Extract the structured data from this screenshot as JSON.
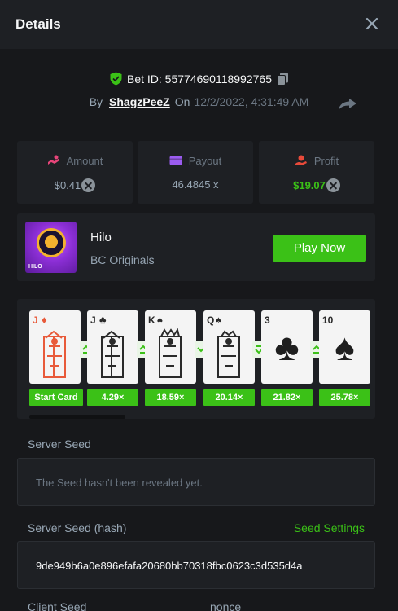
{
  "header": {
    "title": "Details"
  },
  "bet": {
    "id_label": "Bet ID: 55774690118992765",
    "by_label": "By",
    "username": "ShagzPeeZ",
    "on_label": "On",
    "date": "12/2/2022, 4:31:49 AM"
  },
  "stats": [
    {
      "label": "Amount",
      "value": "$0.41"
    },
    {
      "label": "Payout",
      "value": "46.4845 x"
    },
    {
      "label": "Profit",
      "value": "$19.07"
    }
  ],
  "game": {
    "thumb_label": "HILO",
    "name": "Hilo",
    "provider": "BC Originals",
    "play_label": "Play Now"
  },
  "cards": [
    {
      "rank": "J",
      "suit": "♦",
      "color": "red",
      "multiplier": "Start Card"
    },
    {
      "rank": "J",
      "suit": "♣",
      "color": "black",
      "multiplier": "4.29×"
    },
    {
      "rank": "K",
      "suit": "♠",
      "color": "black",
      "multiplier": "18.59×"
    },
    {
      "rank": "Q",
      "suit": "♠",
      "color": "black",
      "multiplier": "20.14×"
    },
    {
      "rank": "3",
      "suit": "♣",
      "color": "black",
      "multiplier": "21.82×"
    },
    {
      "rank": "10",
      "suit": "♠",
      "color": "black",
      "multiplier": "25.78×"
    }
  ],
  "arrows": [
    "higher-or-same",
    "higher-or-same",
    "lower",
    "lower-or-same",
    "higher-or-same"
  ],
  "seeds": {
    "server_seed_label": "Server Seed",
    "server_seed_value": "The Seed hasn't been revealed yet.",
    "server_hash_label": "Server Seed (hash)",
    "seed_settings_label": "Seed Settings",
    "server_hash_value": "9de949b6a0e896efafa20680bb70318fbc0623c3d535d4a",
    "client_seed_label": "Client Seed",
    "nonce_label": "nonce"
  },
  "colors": {
    "accent": "#3bc117",
    "background": "#17181b",
    "card_bg": "#1e2024"
  }
}
